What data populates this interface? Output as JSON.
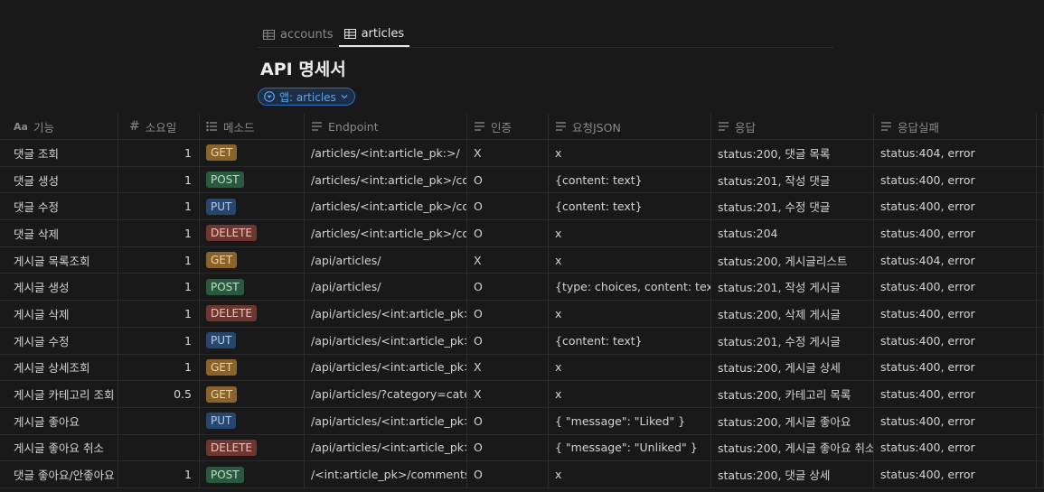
{
  "tabs": [
    {
      "label": "accounts",
      "icon": "table-icon",
      "active": false
    },
    {
      "label": "articles",
      "icon": "table-icon",
      "active": true
    }
  ],
  "page_title": "API 명세서",
  "filter": {
    "label": "앱: articles",
    "icon": "filter-icon"
  },
  "columns": [
    {
      "label": "기능",
      "icon": "title-property-icon"
    },
    {
      "label": "소요일",
      "icon": "number-property-icon"
    },
    {
      "label": "메소드",
      "icon": "multi-select-property-icon"
    },
    {
      "label": "Endpoint",
      "icon": "text-property-icon"
    },
    {
      "label": "인증",
      "icon": "text-property-icon"
    },
    {
      "label": "요청JSON",
      "icon": "text-property-icon"
    },
    {
      "label": "응답",
      "icon": "text-property-icon"
    },
    {
      "label": "응답실패",
      "icon": "text-property-icon"
    }
  ],
  "method_colors": {
    "GET": {
      "bg": "#89632a",
      "fg": "#f2d3a6"
    },
    "POST": {
      "bg": "#2b593f",
      "fg": "#b8e2c6"
    },
    "PUT": {
      "bg": "#28456c",
      "fg": "#b5cdf0"
    },
    "DELETE": {
      "bg": "#6e3630",
      "fg": "#f2c3bc"
    }
  },
  "rows": [
    {
      "name": "댓글 조회",
      "days": "1",
      "method": "GET",
      "endpoint": "/articles/<int:article_pk:>/",
      "auth": "X",
      "request": "x",
      "response": "status:200, 댓글 목록",
      "fail": "status:404, error"
    },
    {
      "name": "댓글 생성",
      "days": "1",
      "method": "POST",
      "endpoint": "/articles/<int:article_pk>/comments/",
      "auth": "O",
      "request": "{content: text}",
      "response": "status:201, 작성 댓글",
      "fail": "status:400, error"
    },
    {
      "name": "댓글 수정",
      "days": "1",
      "method": "PUT",
      "endpoint": "/articles/<int:article_pk>/comments/",
      "auth": "O",
      "request": "{content: text}",
      "response": "status:201, 수정 댓글",
      "fail": "status:400, error"
    },
    {
      "name": "댓글 삭제",
      "days": "1",
      "method": "DELETE",
      "endpoint": "/articles/<int:article_pk>/comments/",
      "auth": "O",
      "request": "x",
      "response": "status:204",
      "fail": "status:400, error"
    },
    {
      "name": "게시글 목록조회",
      "days": "1",
      "method": "GET",
      "endpoint": "/api/articles/",
      "auth": "X",
      "request": "x",
      "response": "status:200, 게시글리스트",
      "fail": "status:404, error"
    },
    {
      "name": "게시글 생성",
      "days": "1",
      "method": "POST",
      "endpoint": "/api/articles/",
      "auth": "O",
      "request": "{type: choices, content: text, u",
      "response": "status:201, 작성 게시글",
      "fail": "status:400, error"
    },
    {
      "name": "게시글 삭제",
      "days": "1",
      "method": "DELETE",
      "endpoint": "/api/articles/<int:article_pk>/",
      "auth": "O",
      "request": "x",
      "response": "status:200, 삭제 게시글",
      "fail": "status:400, error"
    },
    {
      "name": "게시글 수정",
      "days": "1",
      "method": "PUT",
      "endpoint": "/api/articles/<int:article_pk>/",
      "auth": "O",
      "request": "{content: text}",
      "response": "status:201, 수정 게시글",
      "fail": "status:400, error"
    },
    {
      "name": "게시글 상세조회",
      "days": "1",
      "method": "GET",
      "endpoint": "/api/articles/<int:article_pk>/",
      "auth": "X",
      "request": "x",
      "response": "status:200, 게시글 상세",
      "fail": "status:400, error"
    },
    {
      "name": "게시글 카테고리 조회",
      "days": "0.5",
      "method": "GET",
      "endpoint": "/api/articles/?category=category",
      "auth": "X",
      "request": "x",
      "response": "status:200, 카테고리 목록",
      "fail": "status:400, error"
    },
    {
      "name": "게시글 좋아요",
      "days": "",
      "method": "PUT",
      "endpoint": "/api/articles/<int:article_pk>/like/",
      "auth": "O",
      "request": "{ \"message\": \"Liked\" }",
      "response": "status:200, 게시글 좋아요",
      "fail": "status:400, error"
    },
    {
      "name": "게시글 좋아요 취소",
      "days": "",
      "method": "DELETE",
      "endpoint": "/api/articles/<int:article_pk>/like/",
      "auth": "O",
      "request": "{ \"message\": \"Unliked\" }",
      "response": "status:200, 게시글 좋아요 취소",
      "fail": "status:400, error"
    },
    {
      "name": "댓글 좋아요/안좋아요",
      "days": "1",
      "method": "POST",
      "endpoint": "/<int:article_pk>/comments/<int:comment_pk>/",
      "auth": "O",
      "request": "x",
      "response": "status:200, 댓글 상세",
      "fail": "status:400, error"
    }
  ]
}
